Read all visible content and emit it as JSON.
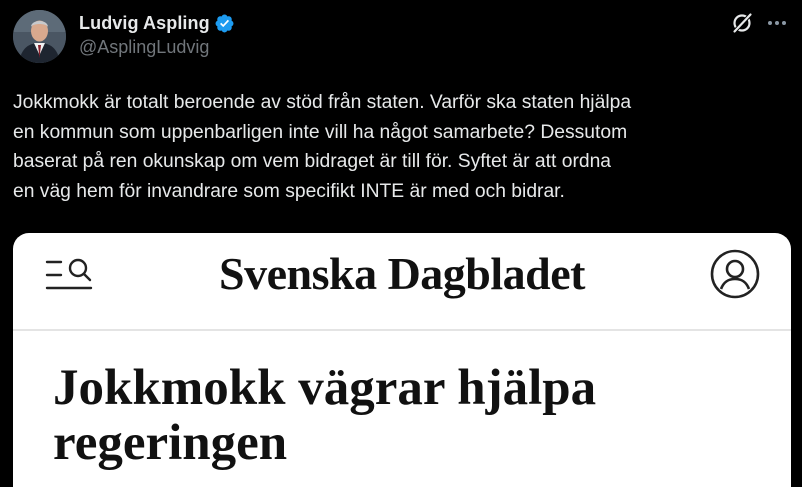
{
  "author": {
    "display_name": "Ludvig Aspling",
    "handle": "@AsplingLudvig",
    "verified": true
  },
  "icons": {
    "verified": "verified-badge-icon",
    "grok": "grok-icon",
    "more": "more-options-icon",
    "site_menu": "menu-search-icon",
    "site_account": "account-icon"
  },
  "tweet": {
    "text": "Jokkmokk är totalt beroende av stöd från staten. Varför ska staten hjälpa\nen kommun som uppenbarligen inte vill ha något samarbete? Dessutom\nbaserat på ren okunskap om vem bidraget är till för. Syftet är att ordna\nen väg hem för invandrare som specifikt INTE är med och bidrar."
  },
  "media": {
    "site_name": "Svenska Dagbladet",
    "headline": "Jokkmokk vägrar hjälpa regeringen"
  },
  "colors": {
    "background": "#000000",
    "text": "#e7e9ea",
    "secondary_text": "#71767b",
    "verified_blue": "#1d9bf0",
    "card_background": "#ffffff",
    "card_text": "#111111"
  }
}
